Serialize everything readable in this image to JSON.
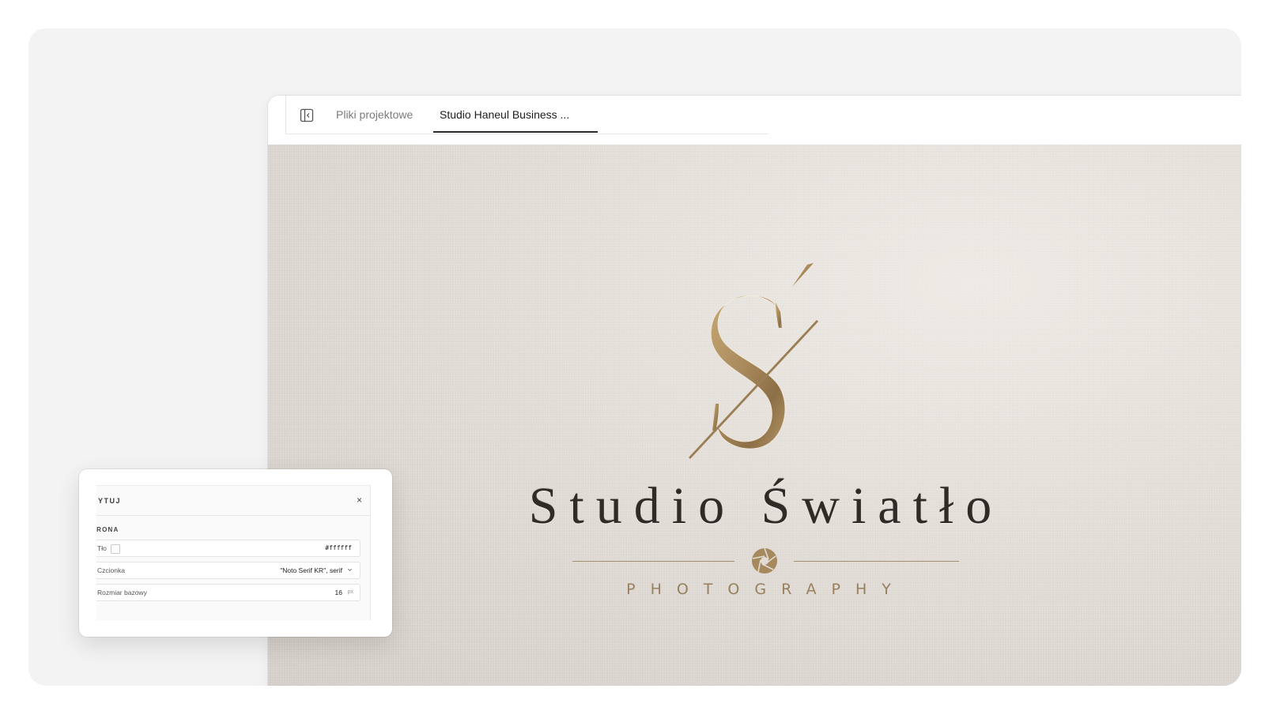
{
  "tabs": {
    "files_label": "Pliki projektowe",
    "active_label": "Studio Haneul Business ..."
  },
  "design": {
    "brand_name": "Studio Światło",
    "tagline": "PHOTOGRAPHY",
    "gold_color": "#a88a5d",
    "text_color": "#2f2b27"
  },
  "editor": {
    "title": "DYTUJ",
    "close_label": "×",
    "section_label": "TRONA",
    "background": {
      "label": "Tło",
      "value": "#ffffff"
    },
    "font": {
      "label": "Czcionka",
      "value": "\"Noto Serif KR\", serif"
    },
    "base_size": {
      "label": "Rozmiar bazowy",
      "value": "16",
      "unit": "px"
    }
  },
  "icons": {
    "panel_toggle": "sidebar-panel-icon",
    "aperture": "camera-aperture-icon",
    "chevron": "chevron-down-icon"
  }
}
